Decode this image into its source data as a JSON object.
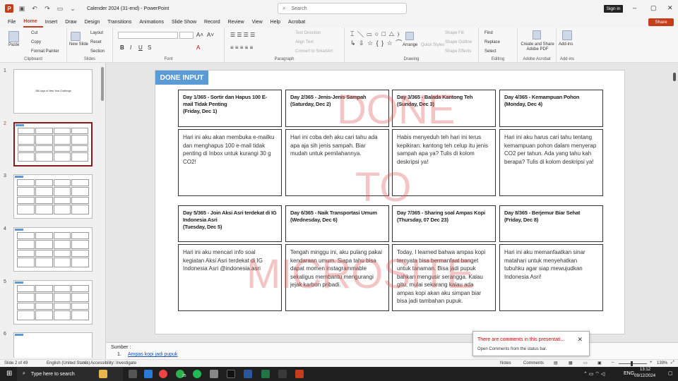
{
  "window": {
    "title": "Calender 2024 (31-end)  -  PowerPoint",
    "search_placeholder": "Search",
    "sign_in": "Sign in",
    "share": "Share"
  },
  "menu": [
    "File",
    "Home",
    "Insert",
    "Draw",
    "Design",
    "Transitions",
    "Animations",
    "Slide Show",
    "Record",
    "Review",
    "View",
    "Help",
    "Acrobat"
  ],
  "ribbon": {
    "clipboard": {
      "paste": "Paste",
      "cut": "Cut",
      "copy": "Copy",
      "format_painter": "Format Painter",
      "label": "Clipboard"
    },
    "slides": {
      "new_slide": "New Slide",
      "layout": "Layout",
      "reset": "Reset",
      "section": "Section",
      "label": "Slides"
    },
    "font": {
      "label": "Font"
    },
    "paragraph": {
      "text_direction": "Text Direction",
      "align_text": "Align Text",
      "convert_smartart": "Convert to SmartArt",
      "label": "Paragraph"
    },
    "drawing": {
      "arrange": "Arrange",
      "quick_styles": "Quick Styles",
      "shape_fill": "Shape Fill",
      "shape_outline": "Shape Outline",
      "shape_effects": "Shape Effects",
      "label": "Drawing"
    },
    "editing": {
      "find": "Find",
      "replace": "Replace",
      "select": "Select",
      "label": "Editing"
    },
    "acrobat": {
      "create_share": "Create and Share Adobe PDF",
      "label": "Adobe Acrobat"
    },
    "addins": {
      "addins": "Add-ins",
      "label": "Add-ins"
    }
  },
  "thumbnails": [
    {
      "num": "1",
      "title": "366 days of New Year Challenge"
    },
    {
      "num": "2"
    },
    {
      "num": "3"
    },
    {
      "num": "4"
    },
    {
      "num": "5"
    },
    {
      "num": "6"
    }
  ],
  "slide": {
    "tag": "DONE INPUT",
    "watermark": [
      "DONE",
      "TO",
      "MICROSITE"
    ],
    "days": [
      {
        "head": "Day 1/365 - Sortir dan Hapus 100 E-mail Tidak Penting\n(Friday, Dec 1)",
        "body": "Hari ini aku akan membuka e-mailku dan menghapus 100 e-mail tidak penting di Inbox untuk kurangi 30 g CO2!"
      },
      {
        "head": "Day 2/365 - Jenis-Jenis Sampah\n(Saturday, Dec 2)",
        "body": "Hari ini coba deh aku cari tahu ada apa aja sih jenis sampah. Biar mudah untuk pemilahannya."
      },
      {
        "head": "Day 3/365 - Balada Kantong Teh\n(Sunday, Dec 3)",
        "body": "Habis menyeduh teh hari ini terus kepikiran: kantong teh celup itu jenis sampah apa ya? Tulis di kolom deskripsi ya!"
      },
      {
        "head": "Day 4/365 - Kemampuan Pohon\n(Monday, Dec 4)",
        "body": "Hari ini aku harus cari tahu tentang kemampuan pohon dalam menyerap CO2 per tahun. Ada yang tahu kah berapa? Tulis di kolom deskripsi ya!"
      },
      {
        "head": "Day 5/365 - Join Aksi Asri terdekat di IG Indonesia Asri\n(Tuesday, Dec 5)",
        "body": "Hari ini aku mencari info soal kegiatan Aksi Asri terdekat di IG Indonesia Asri @indonesia.asri"
      },
      {
        "head": "Day 6/365 - Naik Transportasi Umum\n(Wednesday, Dec 6)",
        "body": "Tengah minggu ini, aku pulang pakai kendaraan umum. Siapa tahu bisa dapat momen instagrammable sekaligus membantu mengurangi jejak karbon pribadi."
      },
      {
        "head": "Day 7/365 - Sharing soal Ampas Kopi\n(Thursday, 07 Dec 23)",
        "body": "Today, I learned bahwa ampas kopi ternyata bisa bermanfaat banget untuk tanaman. Bisa jadi pupuk bahkan mengusir serangga. Kalau gitu, mulai sekarang kalau ada ampas kopi akan aku simpan biar bisa jadi tambahan pupuk."
      },
      {
        "head": "Day 8/365 - Berjemur Biar Sehat\n(Friday, Dec 8)",
        "body": "Hari ini aku memanfaatkan sinar matahari untuk menyehatkan tubuhku agar siap mewujudkan Indonesia Asri!"
      }
    ]
  },
  "notes": {
    "label": "Sumber :",
    "item_num": "1.",
    "link": "Ampas kopi jadi pupuk"
  },
  "toast": {
    "title": "There are comments in this presentati...",
    "body": "Open Comments from the status bar."
  },
  "status": {
    "slide": "Slide 2 of 49",
    "language": "English (United States)",
    "accessibility": "Accessibility: Investigate",
    "notes": "Notes",
    "comments": "Comments",
    "zoom": "139%"
  },
  "taskbar": {
    "search": "Type here to search",
    "lang": "ENG",
    "time": "13:12",
    "date": "09/12/2024",
    "badge": "25"
  },
  "colors": {
    "accent": "#c43e1c",
    "tag": "#5b9bd5",
    "watermark": "#dc5a5a"
  }
}
